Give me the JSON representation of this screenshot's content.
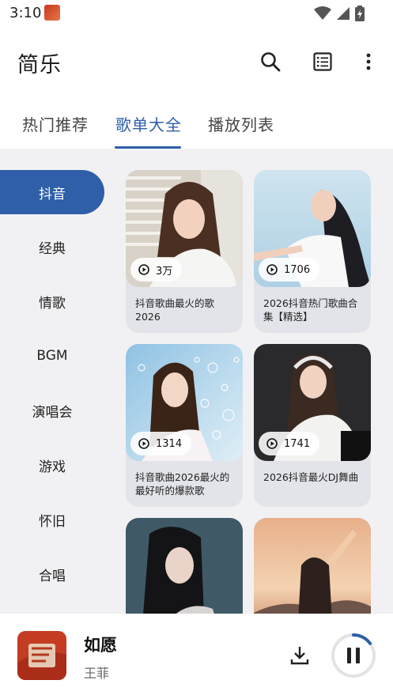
{
  "status": {
    "time": "3:10"
  },
  "app": {
    "title": "简乐"
  },
  "tabs": [
    {
      "label": "热门推荐"
    },
    {
      "label": "歌单大全"
    },
    {
      "label": "播放列表"
    }
  ],
  "categories": [
    {
      "label": "抖音"
    },
    {
      "label": "经典"
    },
    {
      "label": "情歌"
    },
    {
      "label": "BGM"
    },
    {
      "label": "演唱会"
    },
    {
      "label": "游戏"
    },
    {
      "label": "怀旧"
    },
    {
      "label": "合唱"
    }
  ],
  "playlists": [
    {
      "plays": "3万",
      "name": "抖音歌曲最火的歌2026"
    },
    {
      "plays": "1706",
      "name": "2026抖音热门歌曲合集【精选】"
    },
    {
      "plays": "1314",
      "name": "抖音歌曲2026最火的最好听的爆款歌"
    },
    {
      "plays": "1741",
      "name": "2026抖音最火DJ舞曲"
    },
    {
      "plays": "",
      "name": ""
    },
    {
      "plays": "",
      "name": ""
    }
  ],
  "player": {
    "song": "如愿",
    "artist": "王菲",
    "progress": 0.15
  },
  "colors": {
    "accent": "#2f5fa8",
    "background": "#f1f1f3",
    "card": "#e3e4e9"
  }
}
